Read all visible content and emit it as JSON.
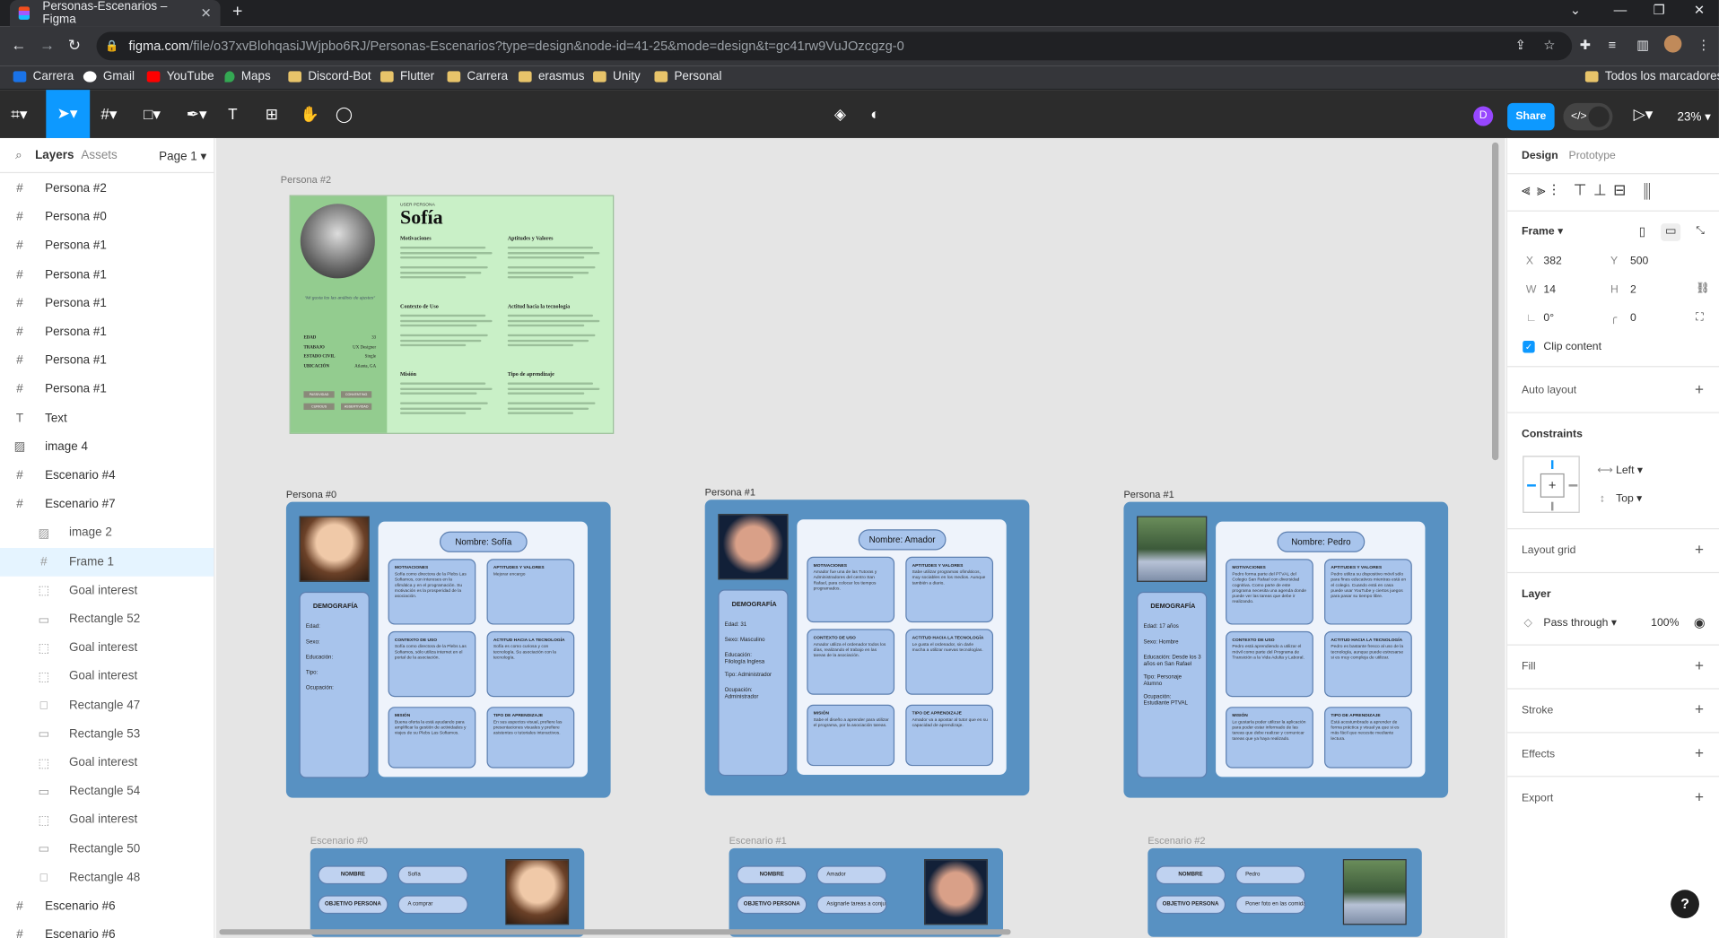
{
  "browser": {
    "tab_title": "Personas-Escenarios – Figma",
    "url_host": "figma.com",
    "url_path": "/file/o37xvBlohqasiJWjpbo6RJ/Personas-Escenarios?type=design&node-id=41-25&mode=design&t=gc41rw9VuJOzcgzg-0",
    "bookmarks": [
      "Carrera",
      "Gmail",
      "YouTube",
      "Maps",
      "Discord-Bot",
      "Flutter",
      "Carrera",
      "erasmus",
      "Unity",
      "Personal"
    ],
    "all_bookmarks": "Todos los marcadores"
  },
  "toolbar": {
    "user_initial": "D",
    "share_label": "Share",
    "zoom": "23%"
  },
  "left_panel": {
    "tabs": {
      "layers": "Layers",
      "assets": "Assets",
      "page": "Page 1"
    },
    "layers": [
      {
        "icon": "#",
        "label": "Persona #2",
        "level": 0
      },
      {
        "icon": "#",
        "label": "Persona #0",
        "level": 0
      },
      {
        "icon": "#",
        "label": "Persona #1",
        "level": 0
      },
      {
        "icon": "#",
        "label": "Persona #1",
        "level": 0
      },
      {
        "icon": "#",
        "label": "Persona #1",
        "level": 0
      },
      {
        "icon": "#",
        "label": "Persona #1",
        "level": 0
      },
      {
        "icon": "#",
        "label": "Persona #1",
        "level": 0
      },
      {
        "icon": "#",
        "label": "Persona #1",
        "level": 0
      },
      {
        "icon": "T",
        "label": "Text",
        "level": 0
      },
      {
        "icon": "▨",
        "label": "image 4",
        "level": 0
      },
      {
        "icon": "#",
        "label": "Escenario #4",
        "level": 0
      },
      {
        "icon": "#",
        "label": "Escenario #7",
        "level": 0
      },
      {
        "icon": "▨",
        "label": "image 2",
        "level": 1
      },
      {
        "icon": "#",
        "label": "Frame 1",
        "level": 1,
        "selected": true
      },
      {
        "icon": "⬚",
        "label": "Goal interest",
        "level": 1
      },
      {
        "icon": "▭",
        "label": "Rectangle 52",
        "level": 1
      },
      {
        "icon": "⬚",
        "label": "Goal interest",
        "level": 1
      },
      {
        "icon": "⬚",
        "label": "Goal interest",
        "level": 1
      },
      {
        "icon": "□",
        "label": "Rectangle 47",
        "level": 1
      },
      {
        "icon": "▭",
        "label": "Rectangle 53",
        "level": 1
      },
      {
        "icon": "⬚",
        "label": "Goal interest",
        "level": 1
      },
      {
        "icon": "▭",
        "label": "Rectangle 54",
        "level": 1
      },
      {
        "icon": "⬚",
        "label": "Goal interest",
        "level": 1
      },
      {
        "icon": "▭",
        "label": "Rectangle 50",
        "level": 1
      },
      {
        "icon": "□",
        "label": "Rectangle 48",
        "level": 1
      },
      {
        "icon": "#",
        "label": "Escenario #6",
        "level": 0
      },
      {
        "icon": "#",
        "label": "Escenario #6",
        "level": 0
      }
    ]
  },
  "canvas": {
    "sofia_card": {
      "frame_label": "Persona #2",
      "kicker": "USER PERSONA",
      "name": "Sofía",
      "quote": "\"Mi gusta los las análisis de ajustes\"",
      "sections": [
        "Motivaciones",
        "Aptitudes y Valores",
        "Contexto de Uso",
        "Actitud hacia la tecnología",
        "Misión",
        "Tipo de aprendizaje"
      ],
      "stats": [
        {
          "k": "EDAD",
          "v": "33"
        },
        {
          "k": "TRABAJO",
          "v": "UX Designer"
        },
        {
          "k": "ESTADO CIVIL",
          "v": "Single"
        },
        {
          "k": "UBICACIÓN",
          "v": "Atlanta, GA"
        }
      ],
      "tags": [
        "PASSIVIDAD",
        "CONVENTING",
        "CURIOUS",
        "ASSERTIVIDAD"
      ]
    },
    "persona_cards": [
      {
        "frame_label": "Persona #0",
        "name": "Nombre: Sofía",
        "demo_title": "DEMOGRAFÍA",
        "demo_lines": [
          "Edad:",
          "Sexo:",
          "Educación:",
          "Tipo:",
          "Ocupación:"
        ],
        "boxes": [
          {
            "t": "MOTIVACIONES",
            "d": "Sofía como directora de la Plebs Las Sofiamos, con intereses en la ofimática y en el programación. Su motivación es la prosperidad de la asociación."
          },
          {
            "t": "APTITUDES Y VALORES",
            "d": "Mejorar encargo"
          },
          {
            "t": "CONTEXTO DE USO",
            "d": "Sofía como directora de la Plebs Las Sofiamos, sólo utiliza internet en el portal de la asociación."
          },
          {
            "t": "ACTITUD HACIA LA TECNOLOGÍA",
            "d": "Sofía es como curiosa y con tecnología. Su asociación con la tecnología."
          },
          {
            "t": "MISIÓN",
            "d": "Buena oferta la está ayudando para amplificar la gestión de actividades y viajes de su Plebs Las Sofiamos."
          },
          {
            "t": "TIPO DE APRENDIZAJE",
            "d": "En sus aspectos visual, prefiere las presentaciones visuales y prefiere asistentes o tutoriales interactivos."
          }
        ]
      },
      {
        "frame_label": "Persona #1",
        "name": "Nombre: Amador",
        "demo_title": "DEMOGRAFÍA",
        "demo_lines": [
          "Edad: 31",
          "Sexo: Masculino",
          "Educación:\nFilología Inglesa",
          "Tipo: Administrador",
          "Ocupación:\nAdministrador"
        ],
        "boxes": [
          {
            "t": "MOTIVACIONES",
            "d": "Amador fue una de las Tutoras y Administradores del centro San Rafael, para colocar los tiempos programados."
          },
          {
            "t": "APTITUDES Y VALORES",
            "d": "Sabe utilizar programas ofimáticos, muy sociables en los medios. Aunque también a diario."
          },
          {
            "t": "CONTEXTO DE USO",
            "d": "Amador utiliza el ordenador todos los días, realizando el trabajo en las tareas de la asociación."
          },
          {
            "t": "ACTITUD HACIA LA TECNOLOGÍA",
            "d": "Le gusta el ordenador, sin darle mucha a utilizar nuevas tecnologías."
          },
          {
            "t": "MISIÓN",
            "d": "Sabe el diseño a aprender para utilizar el programa, por la asociación tareas."
          },
          {
            "t": "TIPO DE APRENDIZAJE",
            "d": "Amador va a apostar al tutor que es su capacidad de aprendizaje."
          }
        ]
      },
      {
        "frame_label": "Persona #1",
        "name": "Nombre: Pedro",
        "demo_title": "DEMOGRAFÍA",
        "demo_lines": [
          "Edad: 17 años",
          "Sexo: Hombre",
          "Educación: Desde los 3\naños en San Rafael",
          "Tipo: Personaje\nAlumno",
          "Ocupación:\nEstudiante PTVAL"
        ],
        "boxes": [
          {
            "t": "MOTIVACIONES",
            "d": "Pedro forma parte del PTVAL del Colegio San Rafael con diversidad cognitiva. Como parte de este programa necesita una agenda donde puede ver las tareas que debe ir realizando."
          },
          {
            "t": "APTITUDES Y VALORES",
            "d": "Pedro utiliza su dispositivo móvil sólo para fines educativos mientras está en el colegio. Cuando está en casa puede usar YouTube y ciertos juegos para pasar su tiempo libre."
          },
          {
            "t": "CONTEXTO DE USO",
            "d": "Pedro está aprendiendo a utilizar el móvil como parte del Programa de Transición a la Vida Adulta y Laboral."
          },
          {
            "t": "ACTITUD HACIA LA TECNOLOGÍA",
            "d": "Pedro es bastante fresco al uso de la tecnología, aunque puede estresarse si es muy compleja de utilizar."
          },
          {
            "t": "MISIÓN",
            "d": "Le gustaría poder utilizar la aplicación para poder estar informado de las tareas que debe realizar y comunicar tareas que ya haya realizado."
          },
          {
            "t": "TIPO DE APRENDIZAJE",
            "d": "Está acostumbrado a aprender de forma práctica y visual ya que si es más fácil que necesite mediante lectura."
          }
        ]
      }
    ],
    "escenario_cards": [
      {
        "frame_label": "Escenario #0",
        "rows": [
          {
            "k": "NOMBRE",
            "v": "Sofía"
          },
          {
            "k": "OBJETIVO PERSONA",
            "v": "A comprar"
          }
        ]
      },
      {
        "frame_label": "Escenario #1",
        "rows": [
          {
            "k": "NOMBRE",
            "v": "Amador"
          },
          {
            "k": "OBJETIVO PERSONA",
            "v": "Asignarle tareas a conjunto de estudiantes"
          }
        ]
      },
      {
        "frame_label": "Escenario #2",
        "rows": [
          {
            "k": "NOMBRE",
            "v": "Pedro"
          },
          {
            "k": "OBJETIVO PERSONA",
            "v": "Poner foto en las comidas"
          }
        ]
      }
    ]
  },
  "right_panel": {
    "tabs": {
      "design": "Design",
      "prototype": "Prototype"
    },
    "frame_label": "Frame",
    "x_label": "X",
    "x": "382",
    "y_label": "Y",
    "y": "500",
    "w_label": "W",
    "w": "14",
    "h_label": "H",
    "h": "2",
    "rotation": "0°",
    "radius": "0",
    "clip_content": "Clip content",
    "auto_layout": "Auto layout",
    "constraints": "Constraints",
    "constraint_h": "Left",
    "constraint_v": "Top",
    "layout_grid": "Layout grid",
    "layer": "Layer",
    "blend": "Pass through",
    "opacity": "100%",
    "fill": "Fill",
    "stroke": "Stroke",
    "effects": "Effects",
    "export": "Export"
  },
  "colors": {
    "accent": "#0d99ff",
    "card_blue": "#5891c2",
    "box_blue": "#a8c4ec",
    "sofia_green": "#c9f0c7"
  }
}
